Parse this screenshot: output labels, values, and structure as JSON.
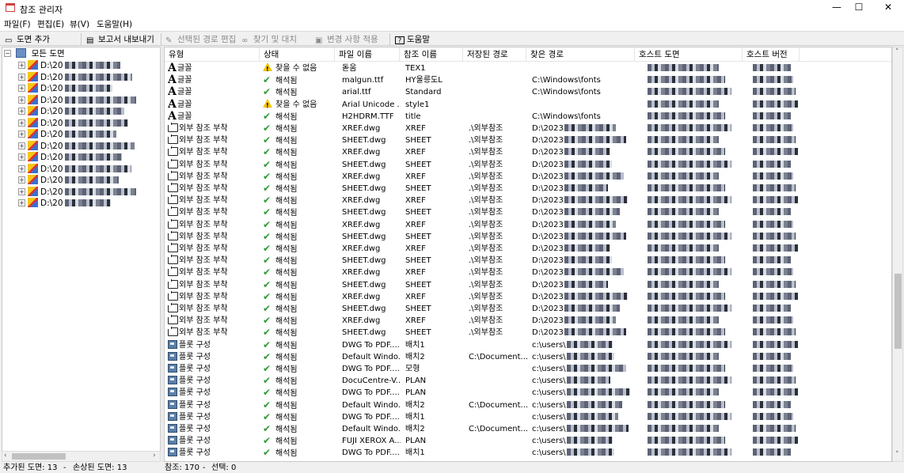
{
  "window": {
    "title": "참조 관리자",
    "minimize": "—",
    "maximize": "☐",
    "close": "✕"
  },
  "menu": [
    "파일(F)",
    "편집(E)",
    "뷰(V)",
    "도움말(H)"
  ],
  "toolbar": {
    "add_drawing": "도면 추가",
    "export_report": "보고서 내보내기",
    "edit_path": "선택된 경로 편집",
    "find_replace": "찾기 및 대치",
    "apply_changes": "변경 사항 적용",
    "help": "도움말"
  },
  "tree": {
    "root_label": "모든 도면",
    "items": [
      "D:\\20",
      "D:\\20",
      "D:\\20",
      "D:\\20",
      "D:\\20",
      "D:\\20",
      "D:\\20",
      "D:\\20",
      "D:\\20",
      "D:\\20",
      "D:\\20",
      "D:\\20",
      "D:\\20"
    ]
  },
  "grid": {
    "headers": [
      "유형",
      "상태",
      "파일 이름",
      "참조 이름",
      "저장된 경로",
      "찾은 경로",
      "호스트 도면",
      "호스트 버전"
    ],
    "rows": [
      {
        "type": "글꼴",
        "icon": "font-icon",
        "status": "찾을 수 없음",
        "status_icon": "warning-icon",
        "file": "돋움",
        "ref": "TEX1",
        "saved": "",
        "found": ""
      },
      {
        "type": "글꼴",
        "icon": "font-icon",
        "status": "해석됨",
        "status_icon": "check-icon",
        "file": "malgun.ttf",
        "ref": "HY울릉도L",
        "saved": "",
        "found": "C:\\Windows\\fonts"
      },
      {
        "type": "글꼴",
        "icon": "font-icon",
        "status": "해석됨",
        "status_icon": "check-icon",
        "file": "arial.ttf",
        "ref": "Standard",
        "saved": "",
        "found": "C:\\Windows\\fonts"
      },
      {
        "type": "글꼴",
        "icon": "font-icon",
        "status": "찾을 수 없음",
        "status_icon": "warning-icon",
        "file": "Arial Unicode ...",
        "ref": "style1",
        "saved": "",
        "found": ""
      },
      {
        "type": "글꼴",
        "icon": "font-icon",
        "status": "해석됨",
        "status_icon": "check-icon",
        "file": "H2HDRM.TTF",
        "ref": "title",
        "saved": "",
        "found": "C:\\Windows\\fonts"
      },
      {
        "type": "외부 참조 부착",
        "icon": "xref-icon",
        "status": "해석됨",
        "status_icon": "check-icon",
        "file": "XREF.dwg",
        "ref": "XREF",
        "saved": ".\\외부참조",
        "found": "D:\\2023"
      },
      {
        "type": "외부 참조 부착",
        "icon": "xref-icon",
        "status": "해석됨",
        "status_icon": "check-icon",
        "file": "SHEET.dwg",
        "ref": "SHEET",
        "saved": ".\\외부참조",
        "found": "D:\\2023"
      },
      {
        "type": "외부 참조 부착",
        "icon": "xref-icon",
        "status": "해석됨",
        "status_icon": "check-icon",
        "file": "XREF.dwg",
        "ref": "XREF",
        "saved": ".\\외부참조",
        "found": "D:\\2023"
      },
      {
        "type": "외부 참조 부착",
        "icon": "xref-icon",
        "status": "해석됨",
        "status_icon": "check-icon",
        "file": "SHEET.dwg",
        "ref": "SHEET",
        "saved": ".\\외부참조",
        "found": "D:\\2023"
      },
      {
        "type": "외부 참조 부착",
        "icon": "xref-icon",
        "status": "해석됨",
        "status_icon": "check-icon",
        "file": "XREF.dwg",
        "ref": "XREF",
        "saved": ".\\외부참조",
        "found": "D:\\2023"
      },
      {
        "type": "외부 참조 부착",
        "icon": "xref-icon",
        "status": "해석됨",
        "status_icon": "check-icon",
        "file": "SHEET.dwg",
        "ref": "SHEET",
        "saved": ".\\외부참조",
        "found": "D:\\2023"
      },
      {
        "type": "외부 참조 부착",
        "icon": "xref-icon",
        "status": "해석됨",
        "status_icon": "check-icon",
        "file": "XREF.dwg",
        "ref": "XREF",
        "saved": ".\\외부참조",
        "found": "D:\\2023"
      },
      {
        "type": "외부 참조 부착",
        "icon": "xref-icon",
        "status": "해석됨",
        "status_icon": "check-icon",
        "file": "SHEET.dwg",
        "ref": "SHEET",
        "saved": ".\\외부참조",
        "found": "D:\\2023"
      },
      {
        "type": "외부 참조 부착",
        "icon": "xref-icon",
        "status": "해석됨",
        "status_icon": "check-icon",
        "file": "XREF.dwg",
        "ref": "XREF",
        "saved": ".\\외부참조",
        "found": "D:\\2023"
      },
      {
        "type": "외부 참조 부착",
        "icon": "xref-icon",
        "status": "해석됨",
        "status_icon": "check-icon",
        "file": "SHEET.dwg",
        "ref": "SHEET",
        "saved": ".\\외부참조",
        "found": "D:\\2023"
      },
      {
        "type": "외부 참조 부착",
        "icon": "xref-icon",
        "status": "해석됨",
        "status_icon": "check-icon",
        "file": "XREF.dwg",
        "ref": "XREF",
        "saved": ".\\외부참조",
        "found": "D:\\2023"
      },
      {
        "type": "외부 참조 부착",
        "icon": "xref-icon",
        "status": "해석됨",
        "status_icon": "check-icon",
        "file": "SHEET.dwg",
        "ref": "SHEET",
        "saved": ".\\외부참조",
        "found": "D:\\2023"
      },
      {
        "type": "외부 참조 부착",
        "icon": "xref-icon",
        "status": "해석됨",
        "status_icon": "check-icon",
        "file": "XREF.dwg",
        "ref": "XREF",
        "saved": ".\\외부참조",
        "found": "D:\\2023"
      },
      {
        "type": "외부 참조 부착",
        "icon": "xref-icon",
        "status": "해석됨",
        "status_icon": "check-icon",
        "file": "SHEET.dwg",
        "ref": "SHEET",
        "saved": ".\\외부참조",
        "found": "D:\\2023"
      },
      {
        "type": "외부 참조 부착",
        "icon": "xref-icon",
        "status": "해석됨",
        "status_icon": "check-icon",
        "file": "XREF.dwg",
        "ref": "XREF",
        "saved": ".\\외부참조",
        "found": "D:\\2023"
      },
      {
        "type": "외부 참조 부착",
        "icon": "xref-icon",
        "status": "해석됨",
        "status_icon": "check-icon",
        "file": "SHEET.dwg",
        "ref": "SHEET",
        "saved": ".\\외부참조",
        "found": "D:\\2023"
      },
      {
        "type": "외부 참조 부착",
        "icon": "xref-icon",
        "status": "해석됨",
        "status_icon": "check-icon",
        "file": "XREF.dwg",
        "ref": "XREF",
        "saved": ".\\외부참조",
        "found": "D:\\2023"
      },
      {
        "type": "외부 참조 부착",
        "icon": "xref-icon",
        "status": "해석됨",
        "status_icon": "check-icon",
        "file": "SHEET.dwg",
        "ref": "SHEET",
        "saved": ".\\외부참조",
        "found": "D:\\2023"
      },
      {
        "type": "플롯 구성",
        "icon": "plot-config-icon",
        "status": "해석됨",
        "status_icon": "check-icon",
        "file": "DWG To PDF....",
        "ref": "배치1",
        "saved": "",
        "found": "c:\\users\\"
      },
      {
        "type": "플롯 구성",
        "icon": "plot-config-icon",
        "status": "해석됨",
        "status_icon": "check-icon",
        "file": "Default Windo...",
        "ref": "배치2",
        "saved": "C:\\Document...",
        "found": "c:\\users\\"
      },
      {
        "type": "플롯 구성",
        "icon": "plot-config-icon",
        "status": "해석됨",
        "status_icon": "check-icon",
        "file": "DWG To PDF....",
        "ref": "모형",
        "saved": "",
        "found": "c:\\users\\"
      },
      {
        "type": "플롯 구성",
        "icon": "plot-config-icon",
        "status": "해석됨",
        "status_icon": "check-icon",
        "file": "DocuCentre-V...",
        "ref": "PLAN",
        "saved": "",
        "found": "c:\\users\\"
      },
      {
        "type": "플롯 구성",
        "icon": "plot-config-icon",
        "status": "해석됨",
        "status_icon": "check-icon",
        "file": "DWG To PDF....",
        "ref": "PLAN",
        "saved": "",
        "found": "c:\\users\\"
      },
      {
        "type": "플롯 구성",
        "icon": "plot-config-icon",
        "status": "해석됨",
        "status_icon": "check-icon",
        "file": "Default Windo...",
        "ref": "배치2",
        "saved": "C:\\Document...",
        "found": "c:\\users\\"
      },
      {
        "type": "플롯 구성",
        "icon": "plot-config-icon",
        "status": "해석됨",
        "status_icon": "check-icon",
        "file": "DWG To PDF....",
        "ref": "배치1",
        "saved": "",
        "found": "c:\\users\\"
      },
      {
        "type": "플롯 구성",
        "icon": "plot-config-icon",
        "status": "해석됨",
        "status_icon": "check-icon",
        "file": "Default Windo...",
        "ref": "배치2",
        "saved": "C:\\Document...",
        "found": "c:\\users\\"
      },
      {
        "type": "플롯 구성",
        "icon": "plot-config-icon",
        "status": "해석됨",
        "status_icon": "check-icon",
        "file": "FUJI XEROX A...",
        "ref": "PLAN",
        "saved": "",
        "found": "c:\\users\\"
      },
      {
        "type": "플롯 구성",
        "icon": "plot-config-icon",
        "status": "해석됨",
        "status_icon": "check-icon",
        "file": "DWG To PDF....",
        "ref": "배치1",
        "saved": "",
        "found": "c:\\users\\"
      }
    ]
  },
  "status": {
    "added": "추가된 도면: 13",
    "damaged": "손상된 도면: 13",
    "refs": "참조: 170",
    "selected": "선택: 0",
    "sep": "-"
  },
  "colors": {
    "check": "#2e9a34",
    "warning": "#f2c400"
  }
}
